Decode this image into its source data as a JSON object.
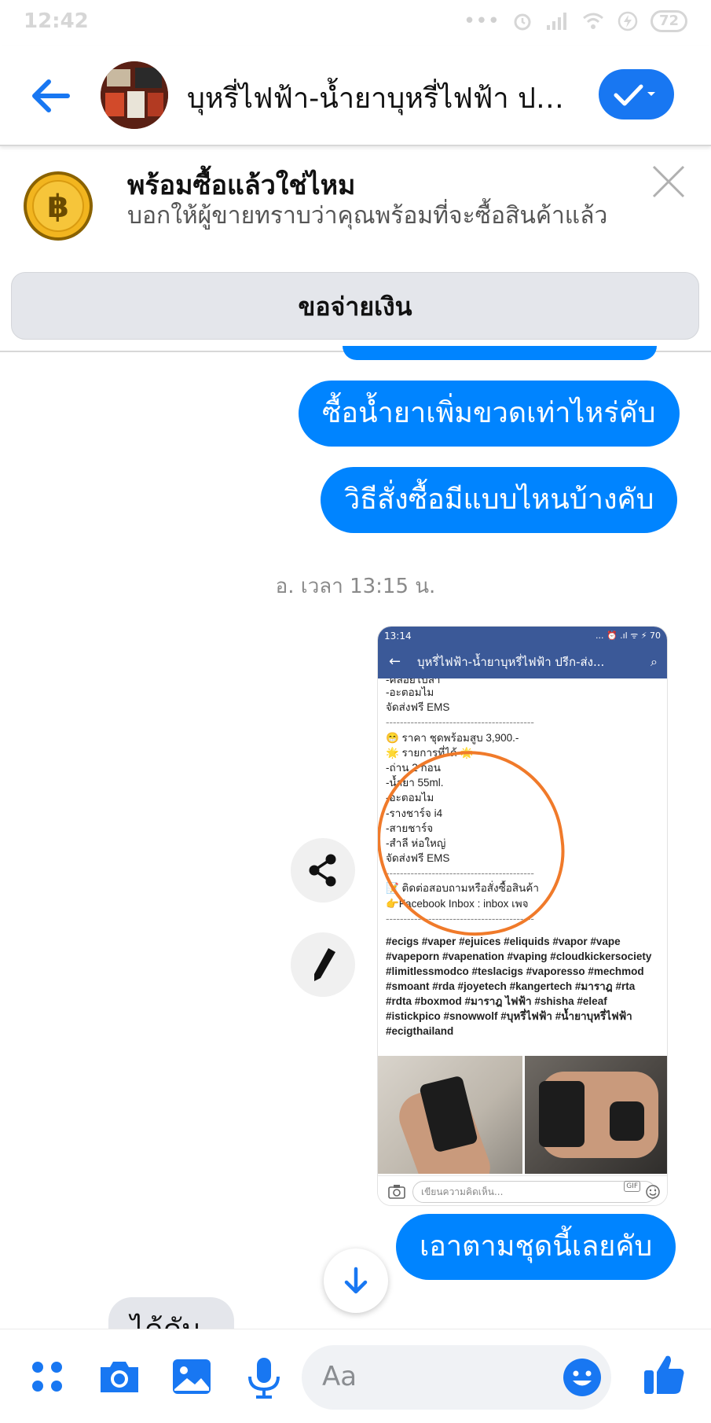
{
  "status_bar": {
    "time": "12:42",
    "battery": "72"
  },
  "header": {
    "title": "บุหรี่ไฟฟ้า-น้ำยาบุหรี่ไฟฟ้า ปรี..."
  },
  "banner": {
    "title": "พร้อมซื้อแล้วใช่ไหม",
    "description": "บอกให้ผู้ขายทราบว่าคุณพร้อมที่จะซื้อสินค้าแล้ว",
    "pay_button": "ขอจ่ายเงิน"
  },
  "messages": {
    "sent_1": "ซื้อน้ำยาเพิ่มขวดเท่าไหร่คับ",
    "sent_2": "วิธีสั่งซื้อมีแบบไหนบ้างคับ",
    "timestamp": "อ. เวลา 13:15 น.",
    "sent_3": "เอาตามชุดนี้เลยคับ",
    "received_partial": "ได้คับ"
  },
  "attachment": {
    "status_time": "13:14",
    "status_icons": "... ⏰ .ıl ᯤ ⚡ 70",
    "nav_title": "บุหรี่ไฟฟ้า-น้ำยาบุหรี่ไฟฟ้า ปรีก-ส่ง...",
    "lines": [
      "-คลอยโบลา",
      "-อะตอมไม",
      "จัดส่งฟรี EMS",
      "------------------------------------------",
      "😁 ราคา ชุดพร้อมสูบ 3,900.-",
      "🌟 รายการที่ได้ 🌟",
      "-ถ่าน 2 ก้อน",
      "-น้ำยา 55ml.",
      "-อะตอมไม",
      "-รางชาร์จ i4",
      "-สายชาร์จ",
      "-สำลี ห่อใหญ่",
      "จัดส่งฟรี EMS",
      "------------------------------------------",
      "📝 ติดต่อสอบถามหรือสั่งซื้อสินค้า",
      "👉Facebook Inbox : inbox เพจ",
      "------------------------------------------"
    ],
    "hashtags": "#ecigs #vaper #ejuices #eliquids #vapor #vape #vapeporn #vapenation #vaping #cloudkickersociety #limitlessmodco #teslacigs #vaporesso #mechmod #smoant #rda #joyetech #kangertech #มาราฎ #rta #rdta #boxmod #มาราฎ ไฟฟ้า #shisha #eleaf #istickpico #snowwolf #บุหรี่ไฟฟ้า #น้ำยาบุหรี่ไฟฟ้า #ecigthailand",
    "comment_placeholder": "เขียนความคิดเห็น...",
    "gif_label": "GIF"
  },
  "composer": {
    "placeholder": "Aa"
  },
  "colors": {
    "messenger_blue": "#0084ff",
    "accent_blue": "#1877f2",
    "gray_button": "#e4e6eb",
    "circle_orange": "#f07a2a",
    "fb_blue": "#3b5998"
  },
  "icons": [
    "back-arrow-icon",
    "check-icon",
    "chevron-down-icon",
    "baht-coin-icon",
    "close-icon",
    "share-icon",
    "pencil-icon",
    "arrow-down-icon",
    "menu-dots-icon",
    "camera-icon",
    "image-icon",
    "microphone-icon",
    "emoji-icon",
    "thumbs-up-icon"
  ]
}
